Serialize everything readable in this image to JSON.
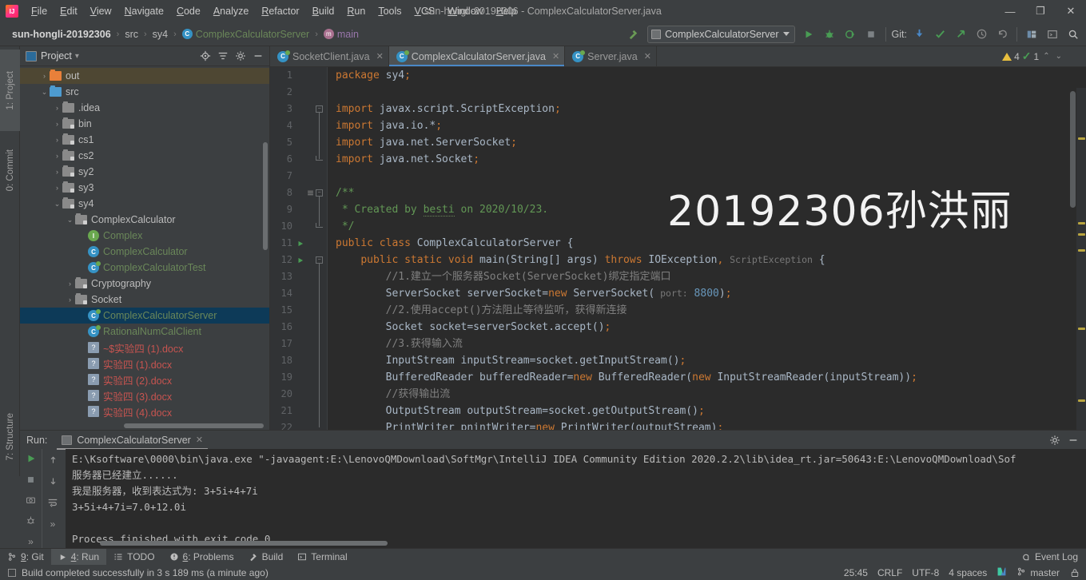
{
  "window": {
    "title": "sun-hongli-20192306 - ComplexCalculatorServer.java",
    "minimize": "—",
    "maximize": "❐",
    "close": "✕"
  },
  "menu": [
    {
      "label": "File"
    },
    {
      "label": "Edit"
    },
    {
      "label": "View"
    },
    {
      "label": "Navigate"
    },
    {
      "label": "Code"
    },
    {
      "label": "Analyze"
    },
    {
      "label": "Refactor"
    },
    {
      "label": "Build"
    },
    {
      "label": "Run"
    },
    {
      "label": "Tools"
    },
    {
      "label": "VCS"
    },
    {
      "label": "Window"
    },
    {
      "label": "Help"
    }
  ],
  "breadcrumb": {
    "project": "sun-hongli-20192306",
    "src": "src",
    "pkg": "sy4",
    "class": "ComplexCalculatorServer",
    "method": "main",
    "separator": "›"
  },
  "toolbar": {
    "build_hammer": "build-hammer",
    "run_config": "ComplexCalculatorServer",
    "run": "▶",
    "debug": "debug",
    "run_coverage": "coverage",
    "stop": "■",
    "git_label": "Git:",
    "update": "update-project",
    "commit": "commit-check",
    "push": "push-arrow",
    "history": "history",
    "rollback": "rollback",
    "layout": "layout",
    "terminal": "terminal",
    "search": "search"
  },
  "left_stripe": [
    {
      "label": "1: Project",
      "active": true
    },
    {
      "label": "0: Commit",
      "active": false
    },
    {
      "label": "7: Structure",
      "active": false
    }
  ],
  "project_panel": {
    "title": "Project",
    "caret": "▾",
    "tools": [
      "locate-icon",
      "expand-collapse-icon",
      "gear-icon",
      "minimize-icon"
    ],
    "tree": [
      {
        "label": "out",
        "indent": 1,
        "arrow": "›",
        "kind": "folder-orange",
        "state": "highlight"
      },
      {
        "label": "src",
        "indent": 1,
        "arrow": "⌄",
        "kind": "folder-src"
      },
      {
        "label": ".idea",
        "indent": 2,
        "arrow": "›",
        "kind": "folder-plain"
      },
      {
        "label": "bin",
        "indent": 2,
        "arrow": "›",
        "kind": "folder-mod"
      },
      {
        "label": "cs1",
        "indent": 2,
        "arrow": "›",
        "kind": "folder-mod"
      },
      {
        "label": "cs2",
        "indent": 2,
        "arrow": "›",
        "kind": "folder-mod"
      },
      {
        "label": "sy2",
        "indent": 2,
        "arrow": "›",
        "kind": "folder-mod"
      },
      {
        "label": "sy3",
        "indent": 2,
        "arrow": "›",
        "kind": "folder-mod"
      },
      {
        "label": "sy4",
        "indent": 2,
        "arrow": "⌄",
        "kind": "folder-mod"
      },
      {
        "label": "ComplexCalculator",
        "indent": 3,
        "arrow": "⌄",
        "kind": "folder-mod"
      },
      {
        "label": "Complex",
        "indent": 4,
        "arrow": "",
        "kind": "iface",
        "color": "green"
      },
      {
        "label": "ComplexCalculator",
        "indent": 4,
        "arrow": "",
        "kind": "class",
        "color": "green"
      },
      {
        "label": "ComplexCalculatorTest",
        "indent": 4,
        "arrow": "",
        "kind": "class-run",
        "color": "green"
      },
      {
        "label": "Cryptography",
        "indent": 3,
        "arrow": "›",
        "kind": "folder-mod"
      },
      {
        "label": "Socket",
        "indent": 3,
        "arrow": "›",
        "kind": "folder-mod"
      },
      {
        "label": "ComplexCalculatorServer",
        "indent": 4,
        "arrow": "",
        "kind": "class-run",
        "color": "green",
        "state": "selected"
      },
      {
        "label": "RationalNumCalClient",
        "indent": 4,
        "arrow": "",
        "kind": "class-run",
        "color": "green"
      },
      {
        "label": "~$实验四 (1).docx",
        "indent": 4,
        "arrow": "",
        "kind": "doc",
        "color": "red"
      },
      {
        "label": "实验四 (1).docx",
        "indent": 4,
        "arrow": "",
        "kind": "doc",
        "color": "red"
      },
      {
        "label": "实验四 (2).docx",
        "indent": 4,
        "arrow": "",
        "kind": "doc",
        "color": "red"
      },
      {
        "label": "实验四 (3).docx",
        "indent": 4,
        "arrow": "",
        "kind": "doc",
        "color": "red"
      },
      {
        "label": "实验四 (4).docx",
        "indent": 4,
        "arrow": "",
        "kind": "doc",
        "color": "red"
      }
    ]
  },
  "editor": {
    "tabs": [
      {
        "label": "SocketClient.java",
        "active": false,
        "close": "✕"
      },
      {
        "label": "ComplexCalculatorServer.java",
        "active": true,
        "close": "✕"
      },
      {
        "label": "Server.java",
        "active": false,
        "close": "✕"
      }
    ],
    "watermark": "20192306孙洪丽",
    "inspection": {
      "warning_count": "4",
      "ok_count": "1",
      "up": "⌃",
      "down": "⌄"
    },
    "lines": [
      {
        "n": 1,
        "html": "<span class=\"kw\">package</span> sy4<span class=\"kw\">;</span>"
      },
      {
        "n": 2,
        "html": ""
      },
      {
        "n": 3,
        "html": "<span class=\"kw\">import</span> javax.script.ScriptException<span class=\"kw\">;</span>",
        "fold": "top"
      },
      {
        "n": 4,
        "html": "<span class=\"kw\">import</span> java.io.*<span class=\"kw\">;</span>"
      },
      {
        "n": 5,
        "html": "<span class=\"kw\">import</span> java.net.ServerSocket<span class=\"kw\">;</span>"
      },
      {
        "n": 6,
        "html": "<span class=\"kw\">import</span> java.net.Socket<span class=\"kw\">;</span>",
        "fold": "bottom"
      },
      {
        "n": 7,
        "html": ""
      },
      {
        "n": 8,
        "html": "<span class=\"jdoc\">/**</span>",
        "fold": "top",
        "mark": true
      },
      {
        "n": 9,
        "html": "<span class=\"jdoc\"> * Created by <span class=\"wavy\">besti</span> on 2020/10/23.</span>"
      },
      {
        "n": 10,
        "html": "<span class=\"jdoc\"> */</span>",
        "fold": "bottom"
      },
      {
        "n": 11,
        "html": "<span class=\"kw\">public class</span> ComplexCalculatorServer {",
        "run": true
      },
      {
        "n": 12,
        "html": "    <span class=\"kw\">public static void</span> main(String[] args) <span class=\"kw\">throws</span> IOException<span class=\"kw\">,</span> <span class=\"hint\">ScriptException</span> {",
        "run": true,
        "fold": "top"
      },
      {
        "n": 13,
        "html": "        <span class=\"cmt\">//1.建立一个服务器Socket(ServerSocket)绑定指定端口</span>"
      },
      {
        "n": 14,
        "html": "        ServerSocket serverSocket=<span class=\"kw\">new</span> ServerSocket(<span class=\"hint\"> port:</span> <span class=\"num\">8800</span>)<span class=\"kw\">;</span>"
      },
      {
        "n": 15,
        "html": "        <span class=\"cmt\">//2.使用accept()方法阻止等待监听，获得新连接</span>"
      },
      {
        "n": 16,
        "html": "        Socket socket=serverSocket.accept()<span class=\"kw\">;</span>"
      },
      {
        "n": 17,
        "html": "        <span class=\"cmt\">//3.获得输入流</span>"
      },
      {
        "n": 18,
        "html": "        InputStream inputStream=socket.getInputStream()<span class=\"kw\">;</span>"
      },
      {
        "n": 19,
        "html": "        BufferedReader bufferedReader=<span class=\"kw\">new</span> BufferedReader(<span class=\"kw\">new</span> InputStreamReader(inputStream))<span class=\"kw\">;</span>"
      },
      {
        "n": 20,
        "html": "        <span class=\"cmt\">//获得输出流</span>"
      },
      {
        "n": 21,
        "html": "        OutputStream outputStream=socket.getOutputStream()<span class=\"kw\">;</span>"
      },
      {
        "n": 22,
        "html": "        PrintWriter pnintWriter=<span class=\"kw\">new</span> PrintWriter(outputStream)<span class=\"kw\">;</span>"
      }
    ]
  },
  "run_panel": {
    "label": "Run:",
    "tab": "ComplexCalculatorServer",
    "tab_close": "✕",
    "header_tools": [
      "gear-icon",
      "minimize-icon"
    ],
    "side_icons": [
      "rerun-play-icon",
      "stop-icon",
      "camera-icon",
      "bug-icon",
      "expand-icon",
      "scroll-up-icon",
      "scroll-down-icon",
      "soft-wrap-icon",
      "more-icon"
    ],
    "console": [
      "E:\\Ksoftware\\0000\\bin\\java.exe \"-javaagent:E:\\LenovoQMDownload\\SoftMgr\\IntelliJ IDEA Community Edition 2020.2.2\\lib\\idea_rt.jar=50643:E:\\LenovoQMDownload\\Sof",
      "服务器已经建立......",
      "我是服务器，收到表达式为: 3+5i+4+7i",
      "3+5i+4+7i=7.0+12.0i",
      "",
      "Process finished with exit code 0"
    ]
  },
  "bottom_tabs": [
    {
      "label": "9: Git",
      "icon": "git-branch-icon",
      "active": false
    },
    {
      "label": "4: Run",
      "icon": "play-icon",
      "active": true
    },
    {
      "label": "TODO",
      "icon": "todo-list-icon",
      "active": false
    },
    {
      "label": "6: Problems",
      "icon": "problems-icon",
      "active": false
    },
    {
      "label": "Build",
      "icon": "hammer-icon",
      "active": false
    },
    {
      "label": "Terminal",
      "icon": "terminal-icon",
      "active": false
    }
  ],
  "event_log": {
    "label": "Event Log",
    "icon": "event-log-icon"
  },
  "status_bar": {
    "message": "Build completed successfully in 3 s 189 ms (a minute ago)",
    "message_icon": "build-status-icon",
    "caret_position": "25:45",
    "line_separator": "CRLF",
    "encoding": "UTF-8",
    "indent": "4 spaces",
    "vcs_icon": "vcs-v-icon",
    "branch_icon": "git-branch-icon",
    "branch": "master",
    "lock_icon": "lock-icon"
  },
  "colors": {
    "accent": "#4a88c7",
    "selection": "#0d3a58",
    "keyword": "#cc7832",
    "string": "#6a8759",
    "comment": "#808080",
    "javadoc": "#629755",
    "number": "#6897bb",
    "warning": "#e8bf3e",
    "ok": "#499c54",
    "error": "#c75450",
    "editor_bg": "#2b2b2b",
    "panel_bg": "#3c3f41"
  }
}
